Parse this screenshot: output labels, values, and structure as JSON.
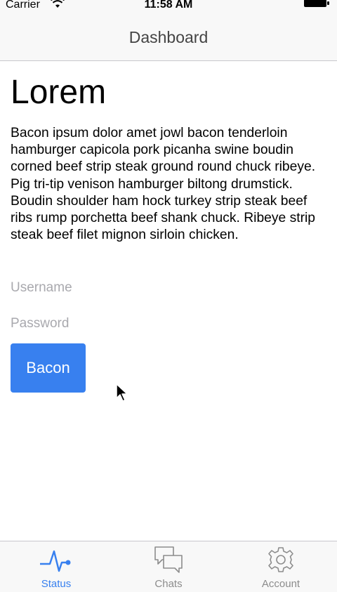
{
  "status_bar": {
    "carrier": "Carrier",
    "time": "11:58 AM"
  },
  "nav": {
    "title": "Dashboard"
  },
  "content": {
    "heading": "Lorem",
    "paragraph": "Bacon ipsum dolor amet jowl bacon tenderloin hamburger capicola pork picanha swine boudin corned beef strip steak ground round chuck ribeye. Pig tri-tip venison hamburger biltong drumstick. Boudin shoulder ham hock turkey strip steak beef ribs rump porchetta beef shank chuck. Ribeye strip steak beef filet mignon sirloin chicken.",
    "username": {
      "placeholder": "Username",
      "value": ""
    },
    "password": {
      "placeholder": "Password",
      "value": ""
    },
    "button_label": "Bacon"
  },
  "tabs": [
    {
      "label": "Status",
      "icon": "pulse-icon",
      "active": true
    },
    {
      "label": "Chats",
      "icon": "chat-bubbles-icon",
      "active": false
    },
    {
      "label": "Account",
      "icon": "gear-icon",
      "active": false
    }
  ],
  "colors": {
    "accent": "#3880ef",
    "inactive_tab": "#8c8c8c",
    "bar_background": "#f8f8f8",
    "placeholder": "#a9a9ae"
  }
}
